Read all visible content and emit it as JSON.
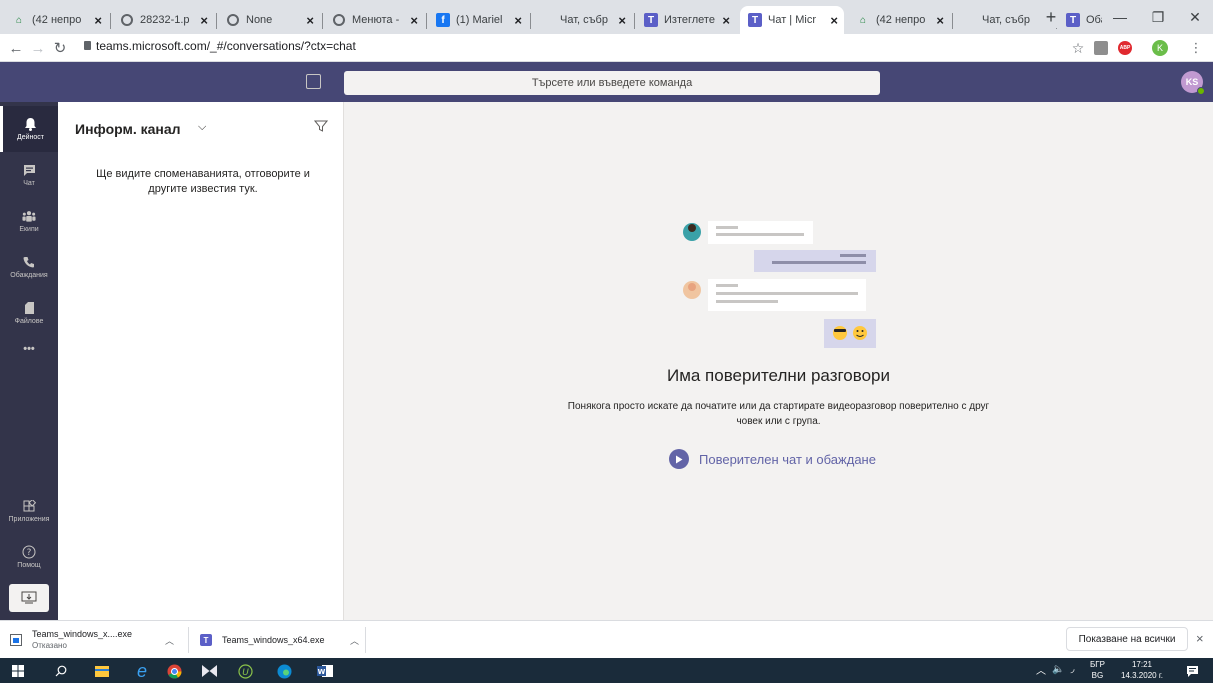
{
  "browser": {
    "tabs": [
      {
        "title": "(42 непро",
        "favicon": "home-icon"
      },
      {
        "title": "28232-1.p",
        "favicon": "globe-icon"
      },
      {
        "title": "None",
        "favicon": "globe-icon"
      },
      {
        "title": "Менюта -",
        "favicon": "globe-icon"
      },
      {
        "title": "(1) Mariel",
        "favicon": "facebook-icon"
      },
      {
        "title": "Чат, събр",
        "favicon": "microsoft-icon"
      },
      {
        "title": "Изтеглете",
        "favicon": "teams-icon"
      },
      {
        "title": "Чат | Micr",
        "favicon": "teams-icon",
        "active": true
      },
      {
        "title": "(42 непро",
        "favicon": "home-icon"
      },
      {
        "title": "Чат, събр",
        "favicon": "microsoft-icon"
      },
      {
        "title": "Обаждан",
        "favicon": "teams-icon"
      }
    ],
    "new_tab": "+",
    "url": "teams.microsoft.com/_#/conversations/?ctx=chat"
  },
  "teams": {
    "search_placeholder": "Търсете или въведете команда",
    "avatar_initials": "KS",
    "rail": [
      {
        "label": "Дейност",
        "icon": "bell-icon"
      },
      {
        "label": "Чат",
        "icon": "chat-icon"
      },
      {
        "label": "Екипи",
        "icon": "teams-icon"
      },
      {
        "label": "Обаждания",
        "icon": "phone-icon"
      },
      {
        "label": "Файлове",
        "icon": "file-icon"
      }
    ],
    "rail_more": "•••",
    "rail_bottom": [
      {
        "label": "Приложения",
        "icon": "apps-icon"
      },
      {
        "label": "Помощ",
        "icon": "help-icon"
      }
    ],
    "panel": {
      "title": "Информ. канал",
      "empty_message": "Ще видите споменаванията, отговорите и другите известия тук."
    },
    "main": {
      "title": "Има поверителни разговори",
      "description": "Понякога просто искате да початите или да стартирате видеоразговор поверително с друг човек или с група.",
      "action": "Поверителен чат и обаждане"
    }
  },
  "downloads": {
    "items": [
      {
        "name": "Teams_windows_x....exe",
        "status": "Отказано"
      },
      {
        "name": "Teams_windows_x64.exe",
        "status": ""
      }
    ],
    "show_all": "Показване на всички"
  },
  "taskbar": {
    "lang_top": "БГР",
    "lang_bottom": "BG",
    "time": "17:21",
    "date": "14.3.2020 г."
  }
}
